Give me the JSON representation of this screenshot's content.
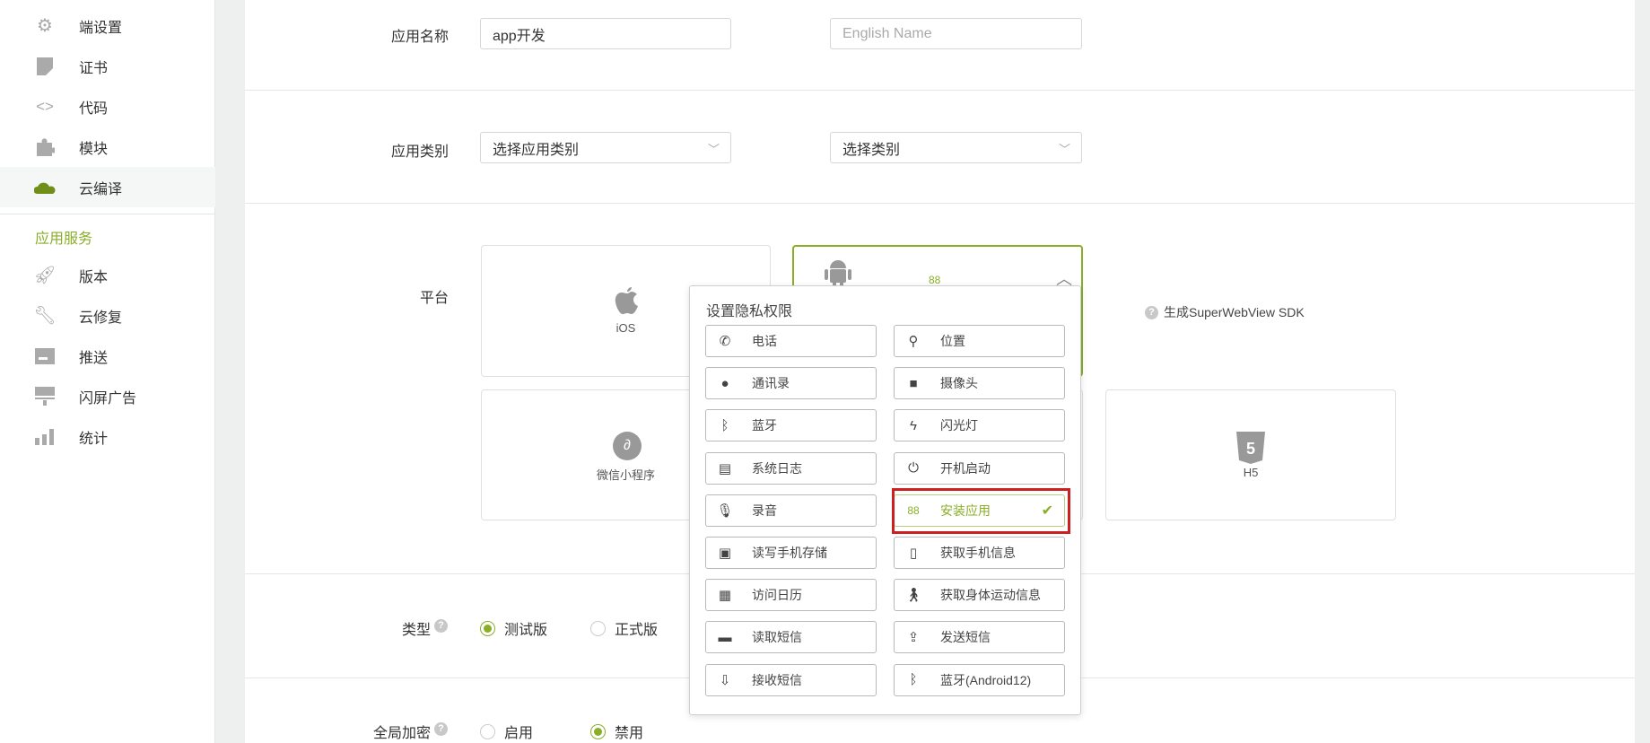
{
  "sidebar": {
    "items": [
      {
        "label": "端设置",
        "icon": "gear-icon"
      },
      {
        "label": "证书",
        "icon": "certificate-icon"
      },
      {
        "label": "代码",
        "icon": "code-icon"
      },
      {
        "label": "模块",
        "icon": "puzzle-icon"
      },
      {
        "label": "云编译",
        "icon": "cloud-icon",
        "active": true
      }
    ],
    "group_label": "应用服务",
    "service_items": [
      {
        "label": "版本",
        "icon": "rocket-icon"
      },
      {
        "label": "云修复",
        "icon": "wrench-icon"
      },
      {
        "label": "推送",
        "icon": "push-icon"
      },
      {
        "label": "闪屏广告",
        "icon": "ad-icon"
      },
      {
        "label": "统计",
        "icon": "bar-chart-icon"
      }
    ]
  },
  "form": {
    "app_name": {
      "label": "应用名称",
      "value": "app开发",
      "english_placeholder": "English Name"
    },
    "app_category": {
      "label": "应用类别",
      "select1": "选择应用类别",
      "select2": "选择类别"
    },
    "platform": {
      "label": "平台",
      "ios": "iOS",
      "wechat": "微信小程序",
      "h5": "H5",
      "sdk_link": "生成SuperWebView SDK"
    },
    "type": {
      "label": "类型",
      "options": [
        "测试版",
        "正式版"
      ],
      "selected": "测试版"
    },
    "encrypt": {
      "label": "全局加密",
      "options": [
        "启用",
        "禁用"
      ],
      "selected": "禁用"
    }
  },
  "popup": {
    "title": "设置隐私权限",
    "items": [
      {
        "label": "电话",
        "icon": "phone-icon"
      },
      {
        "label": "位置",
        "icon": "location-icon"
      },
      {
        "label": "通讯录",
        "icon": "contact-icon"
      },
      {
        "label": "摄像头",
        "icon": "camera-icon"
      },
      {
        "label": "蓝牙",
        "icon": "bluetooth-icon"
      },
      {
        "label": "闪光灯",
        "icon": "flash-icon"
      },
      {
        "label": "系统日志",
        "icon": "file-icon"
      },
      {
        "label": "开机启动",
        "icon": "power-icon"
      },
      {
        "label": "录音",
        "icon": "microphone-icon"
      },
      {
        "label": "安装应用",
        "icon": "apps-icon",
        "checked": true
      },
      {
        "label": "读写手机存储",
        "icon": "save-icon"
      },
      {
        "label": "获取手机信息",
        "icon": "mobile-icon"
      },
      {
        "label": "访问日历",
        "icon": "calendar-icon"
      },
      {
        "label": "获取身体运动信息",
        "icon": "walking-icon"
      },
      {
        "label": "读取短信",
        "icon": "message-icon"
      },
      {
        "label": "发送短信",
        "icon": "upload-icon"
      },
      {
        "label": "接收短信",
        "icon": "download-icon"
      },
      {
        "label": "蓝牙(Android12)",
        "icon": "bluetooth-icon"
      }
    ]
  },
  "colors": {
    "accent": "#8aae28",
    "highlight": "#cc1f1f"
  }
}
